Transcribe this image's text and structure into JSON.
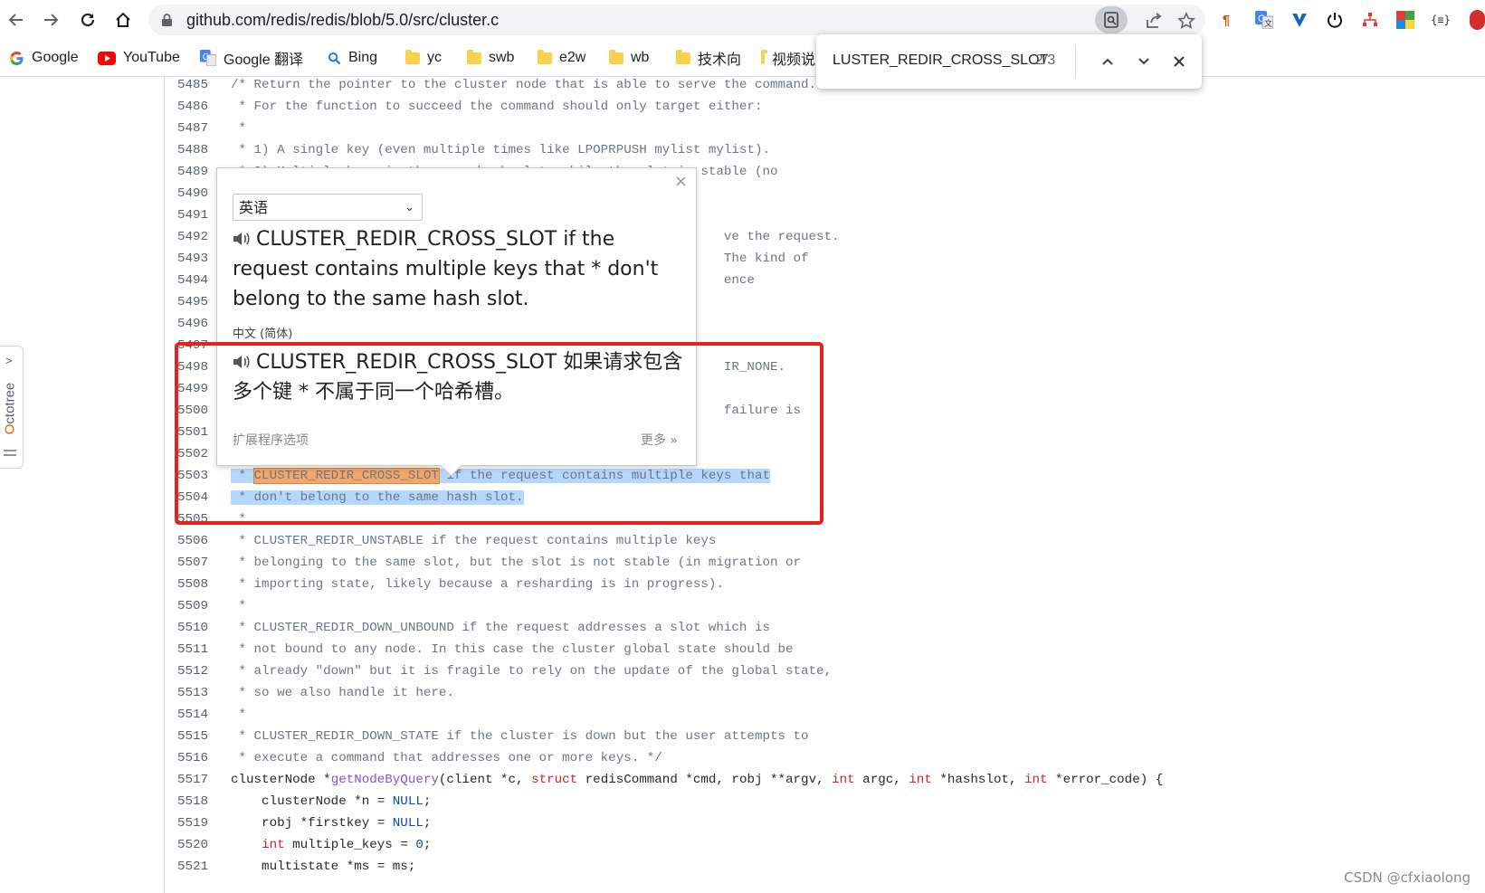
{
  "browser": {
    "url": "github.com/redis/redis/blob/5.0/src/cluster.c",
    "bookmarks": [
      {
        "label": "Google",
        "icon": "google-icon"
      },
      {
        "label": "YouTube",
        "icon": "youtube-icon"
      },
      {
        "label": "Google 翻译",
        "icon": "google-translate-icon"
      },
      {
        "label": "Bing",
        "icon": "search-icon"
      },
      {
        "label": "yc",
        "icon": "folder-icon"
      },
      {
        "label": "swb",
        "icon": "folder-icon"
      },
      {
        "label": "e2w",
        "icon": "folder-icon"
      },
      {
        "label": "wb",
        "icon": "folder-icon"
      },
      {
        "label": "技术向",
        "icon": "folder-icon"
      },
      {
        "label": "视频说",
        "icon": "folder-icon"
      }
    ]
  },
  "find": {
    "query": "LUSTER_REDIR_CROSS_SLOT",
    "count": "2/3"
  },
  "octotree": {
    "first": "O",
    "rest": "ctotree"
  },
  "code": {
    "lines": [
      {
        "n": "5485",
        "t": "/* Return the pointer to the cluster node that is able to serve the command."
      },
      {
        "n": "5486",
        "t": " * For the function to succeed the command should only target either:"
      },
      {
        "n": "5487",
        "t": " *"
      },
      {
        "n": "5488",
        "t": " * 1) A single key (even multiple times like LPOPRPUSH mylist mylist)."
      },
      {
        "n": "5489",
        "t": " * 2) Multiple keys in the same hash slot, while the slot is stable (no"
      },
      {
        "n": "5490",
        "t": ""
      },
      {
        "n": "5491",
        "t": ""
      },
      {
        "n": "5492",
        "t": "                                                                ve the request."
      },
      {
        "n": "5493",
        "t": "                                                                The kind of"
      },
      {
        "n": "5494",
        "t": "                                                                ence"
      },
      {
        "n": "5495",
        "t": ""
      },
      {
        "n": "5496",
        "t": ""
      },
      {
        "n": "5497",
        "t": ""
      },
      {
        "n": "5498",
        "t": "                                                                IR_NONE."
      },
      {
        "n": "5499",
        "t": ""
      },
      {
        "n": "5500",
        "t": "                                                                failure is"
      },
      {
        "n": "5501",
        "t": ""
      },
      {
        "n": "5502",
        "t": ""
      },
      {
        "n": "5503",
        "t": ""
      },
      {
        "n": "5504",
        "t": ""
      },
      {
        "n": "5505",
        "t": " *"
      },
      {
        "n": "5506",
        "t": " * CLUSTER_REDIR_UNSTABLE if the request contains multiple keys"
      },
      {
        "n": "5507",
        "t": " * belonging to the same slot, but the slot is not stable (in migration or"
      },
      {
        "n": "5508",
        "t": " * importing state, likely because a resharding is in progress)."
      },
      {
        "n": "5509",
        "t": " *"
      },
      {
        "n": "5510",
        "t": " * CLUSTER_REDIR_DOWN_UNBOUND if the request addresses a slot which is"
      },
      {
        "n": "5511",
        "t": " * not bound to any node. In this case the cluster global state should be"
      },
      {
        "n": "5512",
        "t": " * already \"down\" but it is fragile to rely on the update of the global state,"
      },
      {
        "n": "5513",
        "t": " * so we also handle it here."
      },
      {
        "n": "5514",
        "t": " *"
      },
      {
        "n": "5515",
        "t": " * CLUSTER_REDIR_DOWN_STATE if the cluster is down but the user attempts to"
      },
      {
        "n": "5516",
        "t": " * execute a command that addresses one or more keys. */"
      },
      {
        "n": "5517",
        "t": ""
      },
      {
        "n": "5518",
        "t": ""
      },
      {
        "n": "5519",
        "t": ""
      },
      {
        "n": "5520",
        "t": ""
      },
      {
        "n": "5521",
        "t": ""
      }
    ],
    "line5503": {
      "prefix": " * ",
      "match": "CLUSTER_REDIR_CROSS_SLOT",
      "suffix": " if the request contains multiple keys that"
    },
    "line5504": {
      "text": " * don't belong to the same hash slot."
    },
    "line5517": {
      "a": "clusterNode *",
      "fn": "getNodeByQuery",
      "b": "(client *c, ",
      "k1": "struct",
      "c": " redisCommand *cmd, robj **argv, ",
      "k2": "int",
      "d": " argc, ",
      "k3": "int",
      "e": " *hashslot, ",
      "k4": "int",
      "f": " *error_code) {"
    },
    "line5518": {
      "a": "    clusterNode *n = ",
      "v": "NULL",
      "b": ";"
    },
    "line5519": {
      "a": "    robj *firstkey = ",
      "v": "NULL",
      "b": ";"
    },
    "line5520": {
      "k": "int",
      "a": " multiple_keys = ",
      "v": "0",
      "b": ";"
    },
    "line5521": {
      "t": "    multistate *ms = ms;"
    }
  },
  "translate": {
    "source_lang": "英语",
    "source_text": "CLUSTER_REDIR_CROSS_SLOT if the request contains multiple keys that * don't belong to the same hash slot.",
    "target_lang": "中文 (简体)",
    "target_text": "CLUSTER_REDIR_CROSS_SLOT 如果请求包含多个键 * 不属于同一个哈希槽。",
    "ext_options": "扩展程序选项",
    "more": "更多 »"
  },
  "watermark": "CSDN @cfxiaolong"
}
